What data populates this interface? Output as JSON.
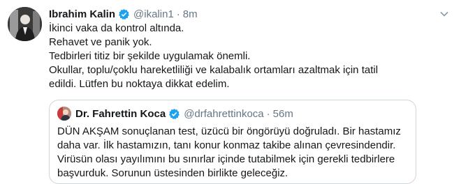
{
  "tweet": {
    "author_name": "Ibrahim Kalin",
    "handle": "@ikalin1",
    "separator": "·",
    "time": "8m",
    "lines": [
      "İkinci vaka da kontrol altında.",
      "Rehavet ve panik yok.",
      "Tedbirleri titiz bir şekilde uygulamak önemli.",
      "Okullar, toplu/çoklu hareketliliği ve kalabalık ortamları azaltmak için tatil",
      "edildi. Lütfen bu noktaya dikkat edelim."
    ]
  },
  "quoted_tweet": {
    "author_name": "Dr. Fahrettin Koca",
    "handle": "@drfahrettinkoca",
    "separator": "·",
    "time": "56m",
    "lines": [
      "DÜN AKŞAM sonuçlanan test, üzücü bir öngörüyü doğruladı. Bir hastamız",
      "daha var. İlk hastamızın, tanı konur konmaz takibe alınan çevresindendir.",
      "Virüsün olası yayılımını bu sınırlar içinde tutabilmek için gerekli tedbirlere",
      "başvurduk. Sorunun üstesinden birlikte geleceğiz."
    ]
  },
  "colors": {
    "verified": "#1da1f2",
    "secondary_text": "#657786",
    "border": "#ccd6dd"
  },
  "icons": {
    "verified": "verified-badge-icon",
    "menu": "chevron-down-icon"
  }
}
